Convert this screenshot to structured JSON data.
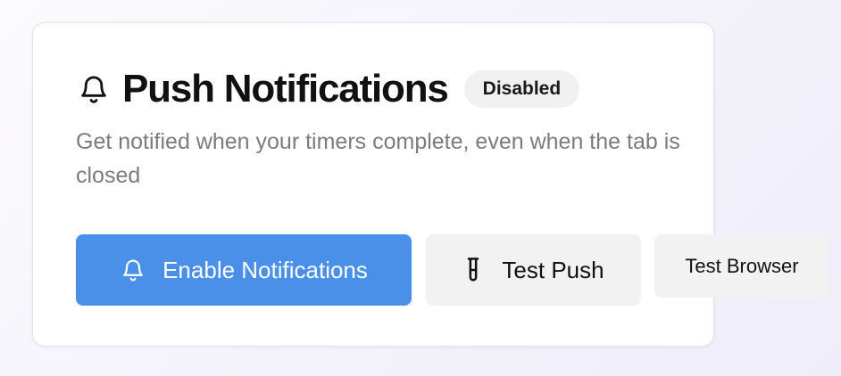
{
  "card": {
    "title": "Push Notifications",
    "title_icon": "bell-icon",
    "status_badge": "Disabled",
    "description": "Get notified when your timers complete, even when the tab is closed"
  },
  "actions": {
    "enable": {
      "label": "Enable Notifications",
      "icon": "bell-icon",
      "color": "#4a90e8"
    },
    "test_push": {
      "label": "Test Push",
      "icon": "test-tube-icon"
    },
    "test_browser": {
      "label": "Test Browser"
    }
  }
}
